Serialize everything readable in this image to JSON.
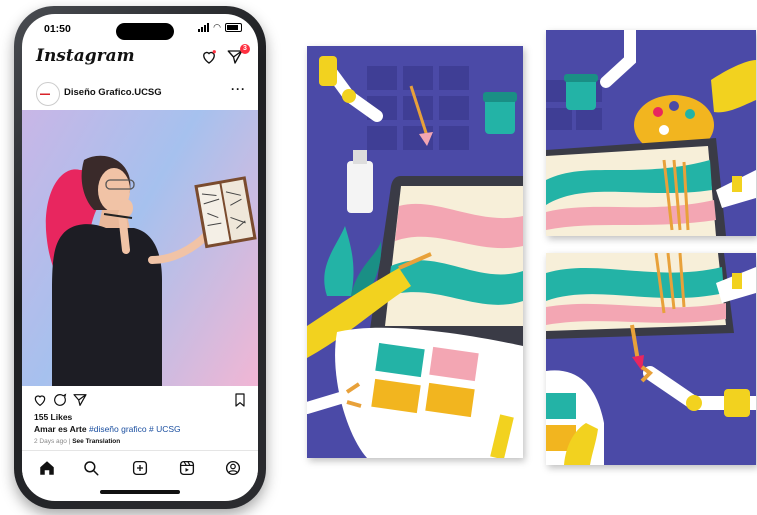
{
  "status": {
    "time": "01:50"
  },
  "app": {
    "name": "Instagram",
    "message_badge": "3"
  },
  "post": {
    "username": "Diseño Grafico.UCSG",
    "more": "···",
    "likes": "155 Likes",
    "caption_user": "Amar es Arte",
    "caption_tags": "#diseño grafico # UCSG",
    "time_ago": "2 Days ago |",
    "see_translation": "See Translation"
  },
  "colors": {
    "panel_bg": "#4b4aa7",
    "tablet": "#3a3b46",
    "robot_yellow": "#f2d21f",
    "teal": "#23b3a6",
    "pink": "#f3a6b3",
    "cream": "#f7efd9",
    "badge": "#ff3040"
  },
  "icons": [
    "heart-icon",
    "messenger-icon",
    "comment-icon",
    "share-icon",
    "bookmark-icon",
    "home-icon",
    "search-icon",
    "new-post-icon",
    "reels-icon",
    "profile-icon"
  ]
}
